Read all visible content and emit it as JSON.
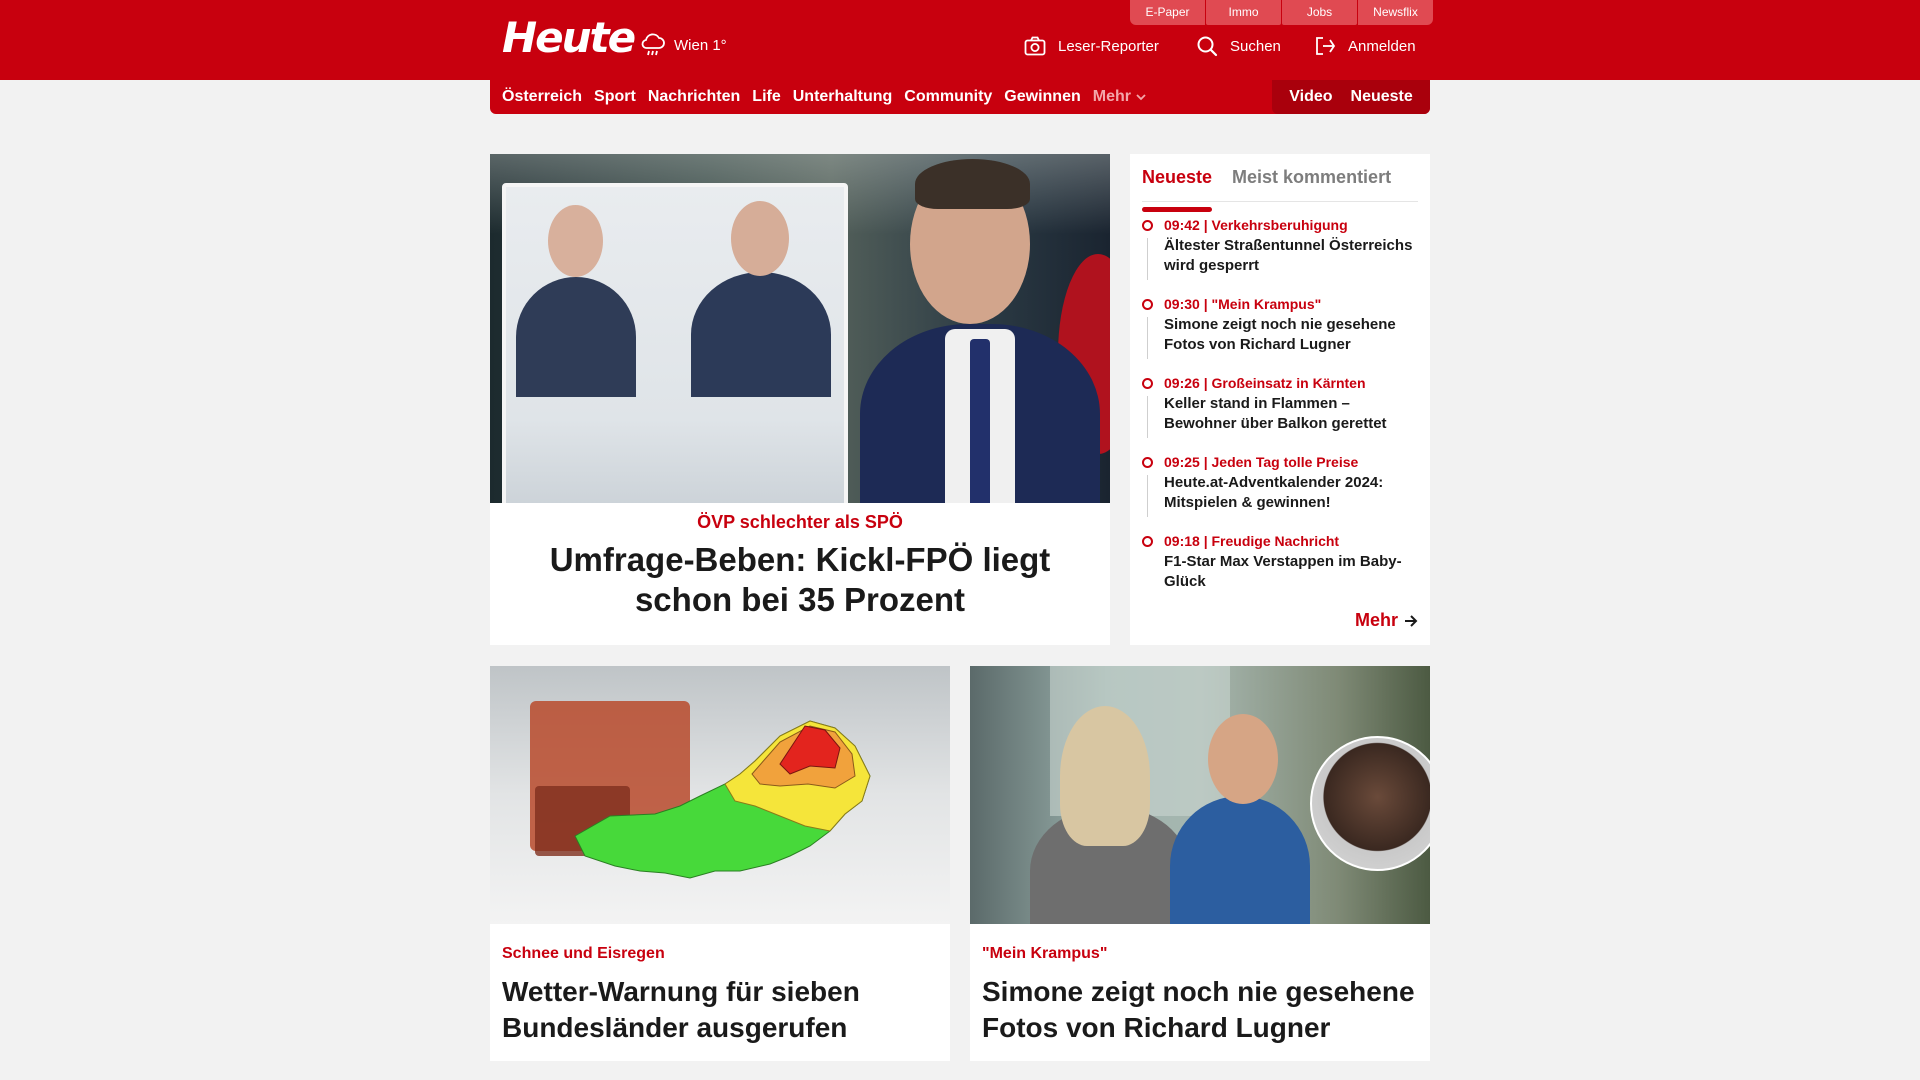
{
  "header": {
    "logo_text": "Heute",
    "weather": {
      "location_temp": "Wien 1°",
      "icon": "rain-cloud-icon"
    },
    "service_links": [
      "E-Paper",
      "Immo",
      "Jobs",
      "Newsflix"
    ],
    "actions": {
      "reporter": "Leser-Reporter",
      "search": "Suchen",
      "login": "Anmelden"
    }
  },
  "nav": {
    "items": [
      "Österreich",
      "Sport",
      "Nachrichten",
      "Life",
      "Unterhaltung",
      "Community",
      "Gewinnen"
    ],
    "more_label": "Mehr",
    "right": [
      "Video",
      "Neueste"
    ]
  },
  "hero": {
    "kicker": "ÖVP schlechter als SPÖ",
    "title": "Umfrage-Beben: Kickl-FPÖ liegt schon bei 35 Prozent"
  },
  "sidebar": {
    "tabs": [
      "Neueste",
      "Meist kommentiert"
    ],
    "items": [
      {
        "meta": "09:42 | Verkehrsberuhigung",
        "title": "Ältester Straßentunnel Österreichs wird gesperrt"
      },
      {
        "meta": "09:30 | \"Mein Krampus\"",
        "title": "Simone zeigt noch nie gesehene Fotos von Richard Lugner"
      },
      {
        "meta": "09:26 | Großeinsatz in Kärnten",
        "title": "Keller stand in Flammen – Bewohner über Balkon gerettet"
      },
      {
        "meta": "09:25 | Jeden Tag tolle Preise",
        "title": "Heute.at-Adventkalender 2024: Mitspielen & gewinnen!"
      },
      {
        "meta": "09:18 | Freudige Nachricht",
        "title": "F1-Star Max Verstappen im Baby-Glück"
      }
    ],
    "more_label": "Mehr"
  },
  "cards": [
    {
      "kicker": "Schnee und Eisregen",
      "title": "Wetter-Warnung für sieben Bundesländer ausgerufen"
    },
    {
      "kicker": "\"Mein Krampus\"",
      "title": "Simone zeigt noch nie gesehene Fotos von Richard Lugner"
    }
  ],
  "colors": {
    "brand_red": "#c8000e",
    "dark_red": "#a9000c",
    "page_bg": "#f2f2f2"
  }
}
